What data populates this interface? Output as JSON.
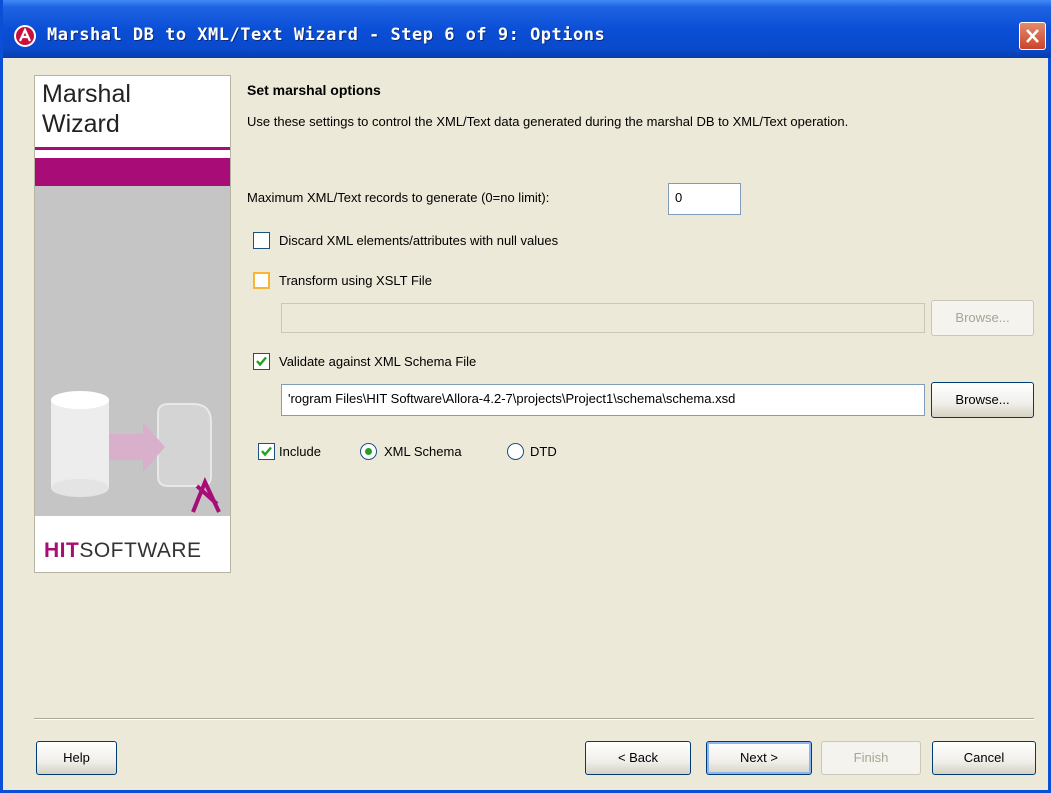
{
  "window": {
    "title": "Marshal DB to XML/Text Wizard - Step 6 of 9: Options"
  },
  "sidepanel": {
    "title_line1": "Marshal",
    "title_line2": "Wizard",
    "logo_hit": "HIT",
    "logo_software": "SOFTWARE",
    "accent_color": "#a80c76"
  },
  "options": {
    "heading": "Set marshal options",
    "description": "Use these settings to control the XML/Text data generated during the marshal DB to XML/Text operation.",
    "max_records_label": "Maximum XML/Text records to generate (0=no limit):",
    "max_records_value": "0",
    "discard_null_label": "Discard XML elements/attributes with null values",
    "discard_null_checked": false,
    "transform_label": "Transform using XSLT File",
    "transform_checked": false,
    "xslt_path": "",
    "xslt_browse_label": "Browse...",
    "validate_label": "Validate against XML Schema File",
    "validate_checked": true,
    "schema_path": "'rogram Files\\HIT Software\\Allora-4.2-7\\projects\\Project1\\schema\\schema.xsd",
    "schema_browse_label": "Browse...",
    "include_label": "Include",
    "include_checked": true,
    "radio_xml_schema_label": "XML Schema",
    "radio_dtd_label": "DTD",
    "selected_format": "XML Schema"
  },
  "footer": {
    "help_label": "Help",
    "back_label": "< Back",
    "next_label": "Next >",
    "finish_label": "Finish",
    "cancel_label": "Cancel"
  },
  "icons": {
    "app": "app-logo-icon",
    "close": "close-icon",
    "check": "checkmark-icon"
  }
}
